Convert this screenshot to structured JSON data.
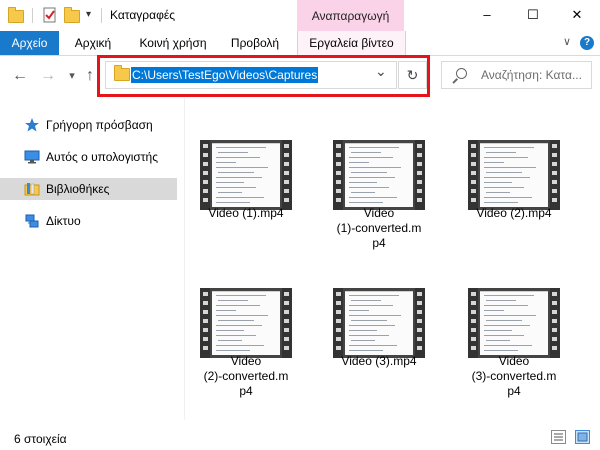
{
  "window": {
    "title": "Καταγραφές",
    "context_tab_label": "Αναπαραγωγή",
    "controls": {
      "minimize": "–",
      "maximize": "☐",
      "close": "✕"
    }
  },
  "ribbon": {
    "tabs": [
      "Αρχείο",
      "Αρχική",
      "Κοινή χρήση",
      "Προβολή",
      "Εργαλεία βίντεο"
    ],
    "collapse": "∨",
    "help": "?"
  },
  "nav": {
    "back": "←",
    "forward": "→",
    "recent": "▾",
    "up": "↑",
    "address": "C:\\Users\\TestEgo\\Videos\\Captures",
    "address_dropdown": "⌄",
    "refresh": "↻",
    "search_placeholder": "Αναζήτηση: Κατα..."
  },
  "sidebar": {
    "items": [
      {
        "label": "Γρήγορη πρόσβαση",
        "icon": "star-icon"
      },
      {
        "label": "Αυτός ο υπολογιστής",
        "icon": "computer-icon"
      },
      {
        "label": "Βιβλιοθήκες",
        "icon": "library-icon",
        "selected": true
      },
      {
        "label": "Δίκτυο",
        "icon": "network-icon"
      }
    ]
  },
  "files": [
    {
      "name": "Video (1).mp4"
    },
    {
      "name": "Video (1)-converted.mp4",
      "lines": [
        "Video",
        "(1)-converted.m",
        "p4"
      ]
    },
    {
      "name": "Video (2).mp4"
    },
    {
      "name": "Video (2)-converted.mp4",
      "lines": [
        "Video",
        "(2)-converted.m",
        "p4"
      ]
    },
    {
      "name": "Video (3).mp4"
    },
    {
      "name": "Video (3)-converted.mp4",
      "lines": [
        "Video",
        "(3)-converted.m",
        "p4"
      ]
    }
  ],
  "status": {
    "count": "6 στοιχεία"
  },
  "colors": {
    "accent": "#1979ca",
    "context_tab": "#fbd3e8",
    "highlight_border": "#e5141b",
    "selection": "#0078d7"
  }
}
